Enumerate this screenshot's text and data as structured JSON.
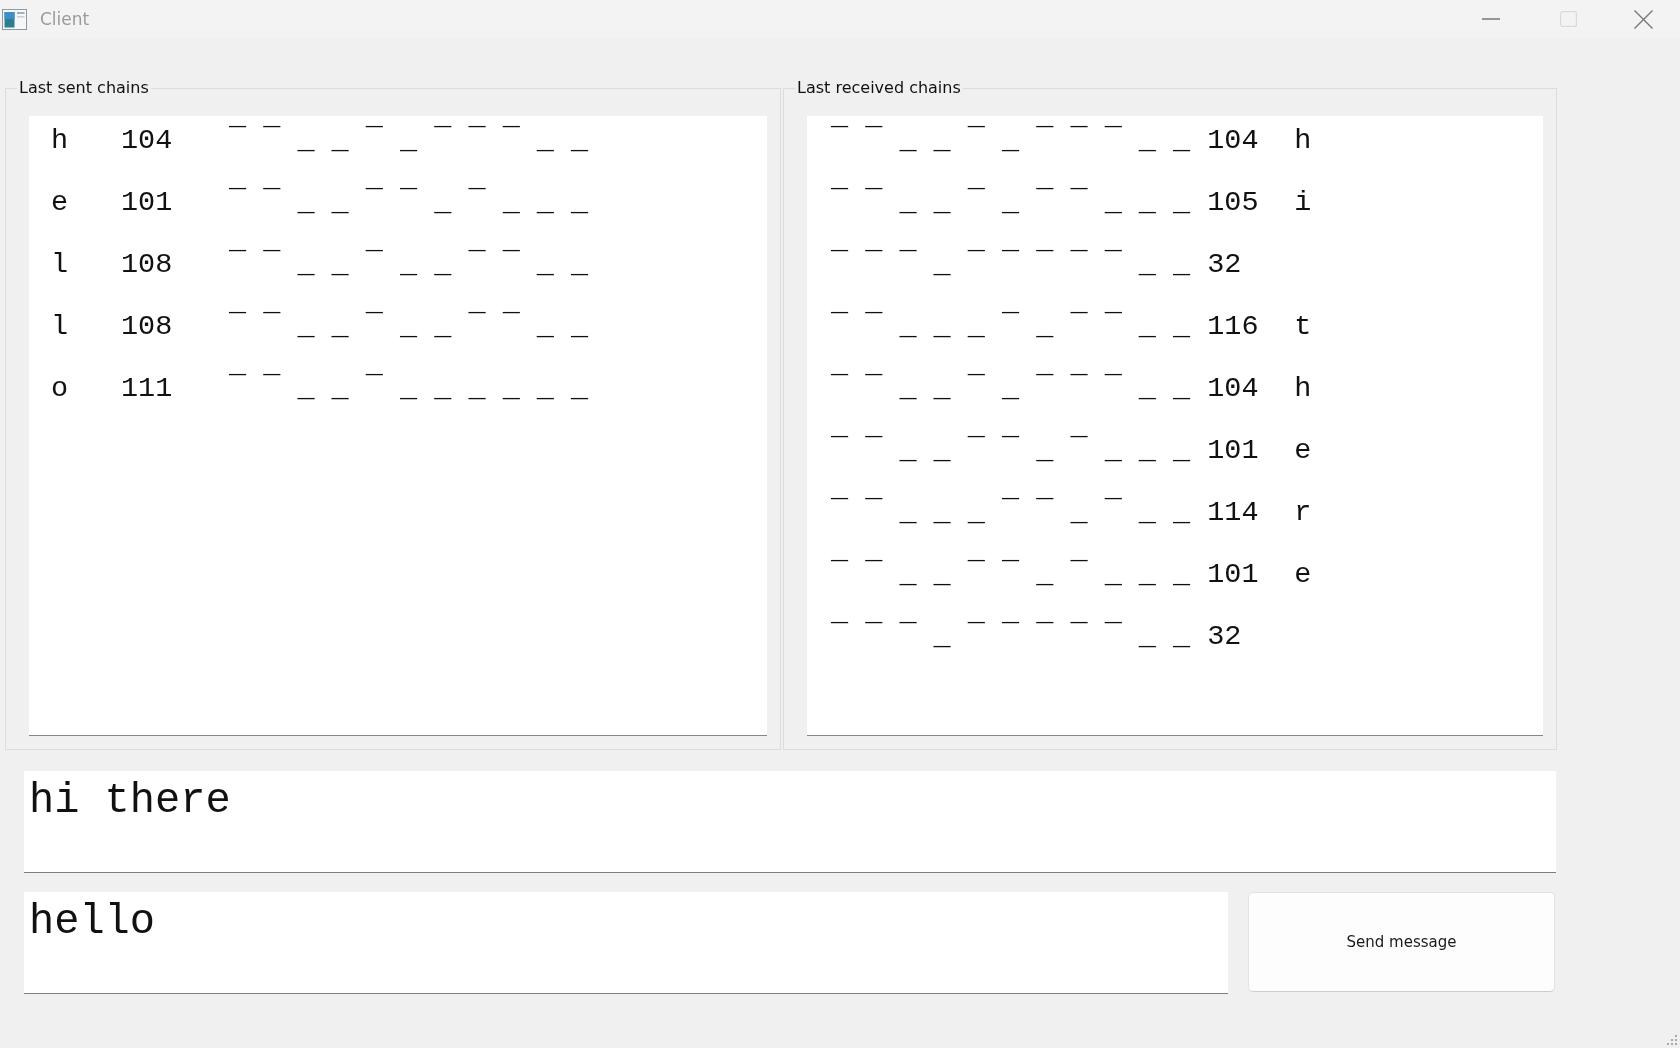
{
  "window": {
    "title": "Client",
    "controls": [
      {
        "kind": "minimize",
        "disabled": false
      },
      {
        "kind": "maximize",
        "disabled": true
      },
      {
        "kind": "close",
        "disabled": false
      }
    ]
  },
  "sent_chains": {
    "title": "Last sent chains",
    "items": [
      {
        "char": "h",
        "code": "104",
        "chain": "¯ ¯ _ _ ¯ _ ¯ ¯ ¯ _ _"
      },
      {
        "char": "e",
        "code": "101",
        "chain": "¯ ¯ _ _ ¯ ¯ _ ¯ _ _ _"
      },
      {
        "char": "l",
        "code": "108",
        "chain": "¯ ¯ _ _ ¯ _ _ ¯ ¯ _ _"
      },
      {
        "char": "l",
        "code": "108",
        "chain": "¯ ¯ _ _ ¯ _ _ ¯ ¯ _ _"
      },
      {
        "char": "o",
        "code": "111",
        "chain": "¯ ¯ _ _ ¯ _ _ _ _ _ _"
      }
    ]
  },
  "received_chains": {
    "title": "Last received chains",
    "items": [
      {
        "chain": "¯ ¯ _ _ ¯ _ ¯ ¯ ¯ _ _",
        "code": "104",
        "char": "h"
      },
      {
        "chain": "¯ ¯ _ _ ¯ _ ¯ ¯ _ _ _",
        "code": "105",
        "char": "i"
      },
      {
        "chain": "¯ ¯ ¯ _ ¯ ¯ ¯ ¯ ¯ _ _",
        "code": "32"
      },
      {
        "chain": "¯ ¯ _ _ _ ¯ _ ¯ ¯ _ _",
        "code": "116",
        "char": "t"
      },
      {
        "chain": "¯ ¯ _ _ ¯ _ ¯ ¯ ¯ _ _",
        "code": "104",
        "char": "h"
      },
      {
        "chain": "¯ ¯ _ _ ¯ ¯ _ ¯ _ _ _",
        "code": "101",
        "char": "e"
      },
      {
        "chain": "¯ ¯ _ _ _ ¯ ¯ _ ¯ _ _",
        "code": "114",
        "char": "r"
      },
      {
        "chain": "¯ ¯ _ _ ¯ ¯ _ ¯ _ _ _",
        "code": "101",
        "char": "e"
      },
      {
        "chain": "¯ ¯ ¯ _ ¯ ¯ ¯ ¯ ¯ _ _",
        "code": "32"
      }
    ]
  },
  "received_text": {
    "value": "hi there"
  },
  "message_input": {
    "value": "hello"
  },
  "send_button": {
    "label": "Send message"
  }
}
